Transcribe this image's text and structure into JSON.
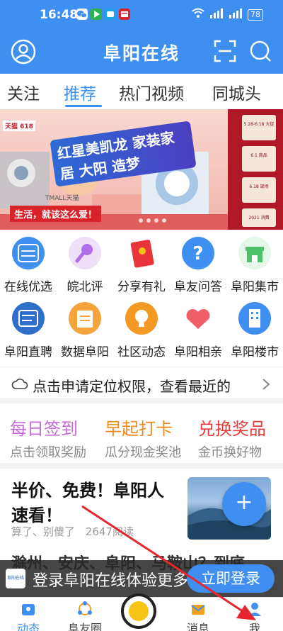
{
  "status_bar": {
    "time": "16:48",
    "battery": "78",
    "apps": [
      {
        "name": "wechat-icon",
        "color": "#e8e8e8"
      },
      {
        "name": "play-icon",
        "color": "#2cb34a"
      },
      {
        "name": "video-icon",
        "color": "#1fa2e8"
      },
      {
        "name": "news-app-icon",
        "color": "#d9232b"
      }
    ]
  },
  "header": {
    "title": "阜阳在线"
  },
  "tabs": [
    {
      "label": "关注",
      "active": false
    },
    {
      "label": "推荐",
      "active": true
    },
    {
      "label": "热门视频",
      "active": false
    },
    {
      "label": "同城头",
      "active": false
    }
  ],
  "banner": {
    "mall_tag": "天猫 618",
    "headline": "红星美凯龙 家装家居 大阳 造梦",
    "slogan": "生活，就该这么爱！",
    "tmall": "TMALL天猫",
    "side_cards": [
      "5.28-6.18 大促",
      "6.1 商品",
      "6.18 现场",
      "2021 消费"
    ]
  },
  "grid": {
    "rows": [
      [
        {
          "label": "在线优选",
          "icon": "zaixian-youxuan-icon",
          "color": "#3e8ff0"
        },
        {
          "label": "皖北评",
          "icon": "microphone-icon",
          "color": "#b06ee8"
        },
        {
          "label": "分享有礼",
          "icon": "red-envelope-icon",
          "color": "#e8343a"
        },
        {
          "label": "阜友问答",
          "icon": "question-icon",
          "color": "#3e8ff0"
        },
        {
          "label": "阜阳集市",
          "icon": "market-icon",
          "color": "#4cc36b"
        }
      ],
      [
        {
          "label": "阜阳直聘",
          "icon": "pin-icon",
          "color": "#2f6fc9"
        },
        {
          "label": "数据阜阳",
          "icon": "folder-icon",
          "color": "#f4a43a"
        },
        {
          "label": "社区动态",
          "icon": "lightbulb-icon",
          "color": "#f49a24"
        },
        {
          "label": "阜阳相亲",
          "icon": "hearts-icon",
          "color": "#f0606a"
        },
        {
          "label": "阜阳楼市",
          "icon": "building-icon",
          "color": "#3e8ff0"
        }
      ]
    ]
  },
  "location": {
    "text": "点击申请定位权限，查看最近的"
  },
  "activities": [
    {
      "title": "每日签到",
      "subtitle": "点击领取奖励",
      "color": "#c76ad9"
    },
    {
      "title": "早起打卡",
      "subtitle": "瓜分现金奖池",
      "color": "#f08a1d"
    },
    {
      "title": "兑换奖品",
      "subtitle": "金币换好物",
      "color": "#e83c3c"
    }
  ],
  "news": {
    "title": "半价、免费！阜阳人速看！",
    "source": "算了、别傻了",
    "reads": "2647阅读"
  },
  "news2": {
    "title": "滁州、安庆、阜阳、马鞍山？到底"
  },
  "login_banner": {
    "logo": "阜阳在线",
    "text": "登录阜阳在线体验更多",
    "button": "立即登录"
  },
  "bottom_nav": [
    {
      "label": "动态",
      "icon": "home-feed-icon",
      "active": true
    },
    {
      "label": "阜友圈",
      "icon": "friends-circle-icon",
      "active": false
    },
    {
      "label": "",
      "icon": "publish-center-icon",
      "active": false
    },
    {
      "label": "消息",
      "icon": "message-icon",
      "active": false
    },
    {
      "label": "我",
      "icon": "profile-icon",
      "active": false
    }
  ],
  "fab": {
    "symbol": "+"
  },
  "colors": {
    "brand": "#3e8ff0",
    "annotation_arrow": "#e6262e"
  }
}
